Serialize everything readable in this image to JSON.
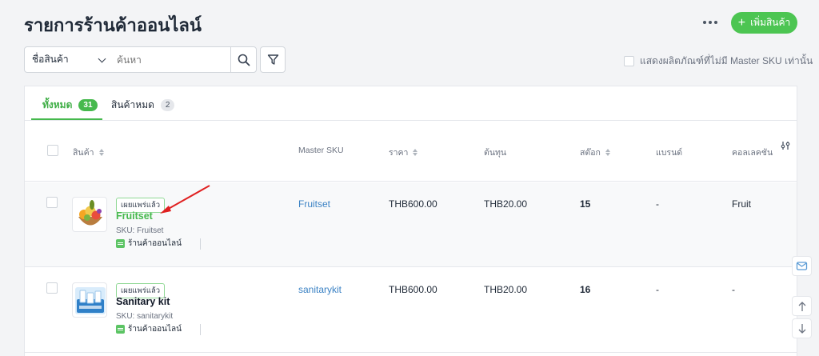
{
  "header": {
    "title": "รายการร้านค้าออนไลน์",
    "add_button_label": "เพิ่มสินค้า"
  },
  "filters": {
    "field_select_value": "ชื่อสินค้า",
    "search_placeholder": "ค้นหา",
    "show_without_sku_label": "แสดงผลิตภัณฑ์ที่ไม่มี Master SKU เท่านั้น"
  },
  "tabs": [
    {
      "label": "ทั้งหมด",
      "count": "31"
    },
    {
      "label": "สินค้าหมด",
      "count": "2"
    }
  ],
  "columns": {
    "product": "สินค้า",
    "master_sku": "Master SKU",
    "price": "ราคา",
    "cost": "ต้นทุน",
    "stock": "สต๊อก",
    "brand": "แบรนด์",
    "collection": "คอลเลคชัน"
  },
  "rows": [
    {
      "status": "เผยแพร่แล้ว",
      "name": "Fruitset",
      "sku": "SKU: Fruitset",
      "store": "ร้านค้าออนไลน์",
      "master_sku": "Fruitset",
      "price": "THB600.00",
      "cost": "THB20.00",
      "stock": "15",
      "brand": "-",
      "collection": "Fruit"
    },
    {
      "status": "เผยแพร่แล้ว",
      "name": "Sanitary kit",
      "sku": "SKU: sanitarykit",
      "store": "ร้านค้าออนไลน์",
      "master_sku": "sanitarykit",
      "price": "THB600.00",
      "cost": "THB20.00",
      "stock": "16",
      "brand": "-",
      "collection": "-"
    }
  ],
  "colors": {
    "accent_green": "#46b94d",
    "link_blue": "#3b82c4",
    "annotation_arrow": "#e02020"
  }
}
